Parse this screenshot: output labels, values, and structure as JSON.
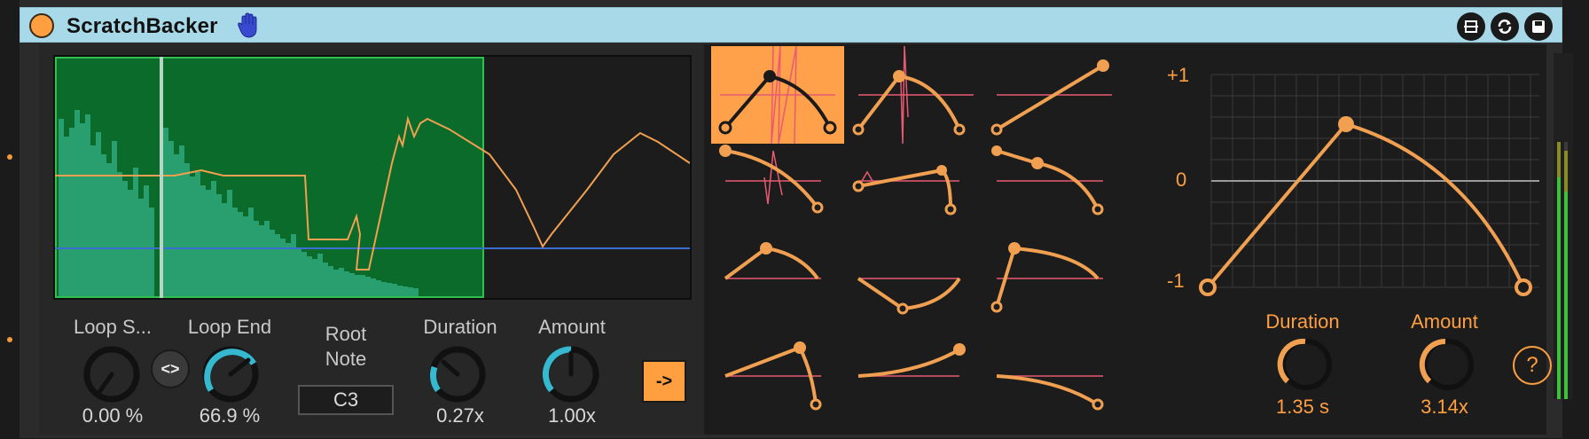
{
  "device": {
    "title": "ScratchBacker",
    "power_icon": "power-toggle",
    "hand_icon": "hand-icon",
    "title_buttons": [
      "unfold-icon",
      "refresh-icon",
      "save-icon"
    ]
  },
  "colors": {
    "accent": "#ff9f40",
    "title_bg": "#a8d9e8",
    "loop_region": "#0a6b2a",
    "waveform": "#2fa87a",
    "curve": "#f0a050",
    "pink_line": "#e85a72",
    "blue_line": "#3a6ed0",
    "knob_teal": "#36b8d0"
  },
  "controls": {
    "loop_start": {
      "label": "Loop S...",
      "value": "0.00 %"
    },
    "swap_label": "<>",
    "loop_end": {
      "label": "Loop End",
      "value": "66.9 %"
    },
    "root_note": {
      "label_line1": "Root",
      "label_line2": "Note",
      "value": "C3"
    },
    "duration": {
      "label": "Duration",
      "value": "0.27x"
    },
    "amount": {
      "label": "Amount",
      "value": "1.00x"
    },
    "apply_label": "->"
  },
  "curve_editor": {
    "y_max_label": "+1",
    "y_zero_label": "0",
    "y_min_label": "-1",
    "duration": {
      "label": "Duration",
      "value": "1.35 s"
    },
    "amount": {
      "label": "Amount",
      "value": "3.14x"
    },
    "help_label": "?"
  }
}
